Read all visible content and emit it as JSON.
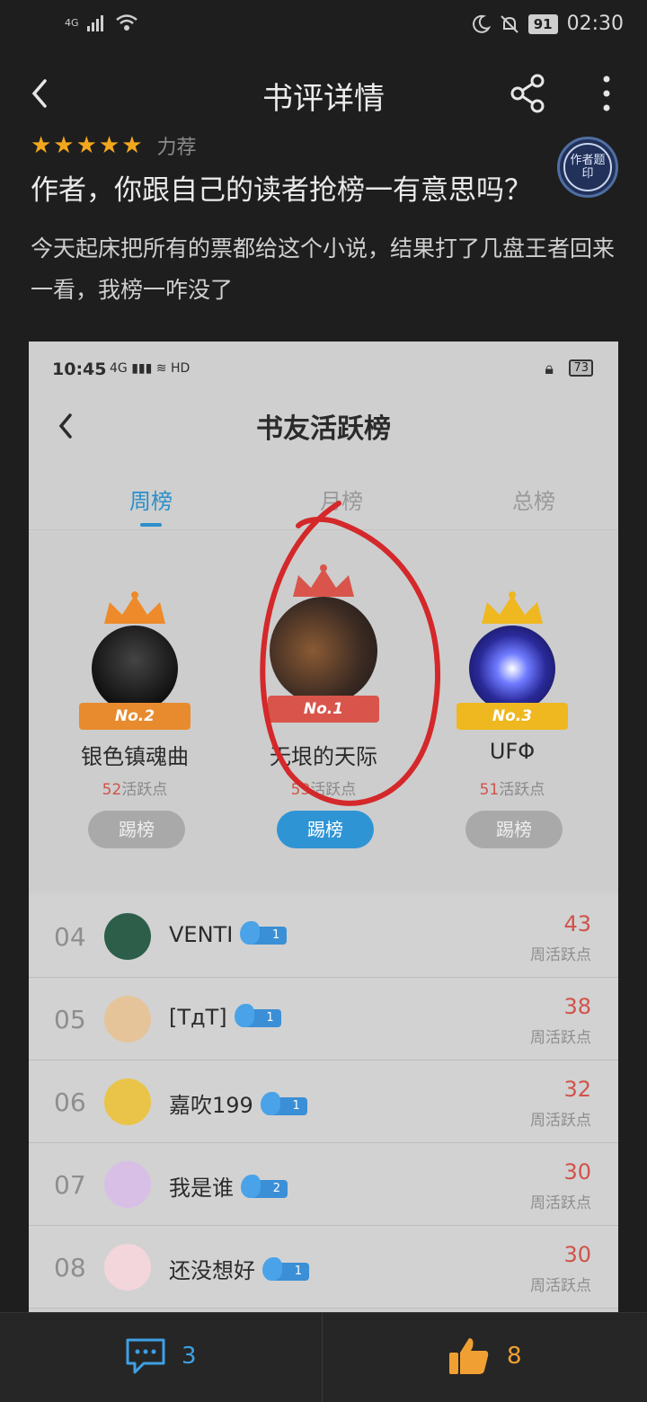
{
  "status_bar": {
    "network": "4G",
    "battery": "91",
    "time": "02:30"
  },
  "appbar": {
    "title": "书评详情"
  },
  "review": {
    "stars": "★★★★★",
    "rating_label": "力荐",
    "title": "作者，你跟自己的读者抢榜一有意思吗？",
    "stamp_text": "作者题印",
    "body": "今天起床把所有的票都给这个小说，结果打了几盘王者回来一看，我榜一咋没了"
  },
  "screenshot": {
    "status": {
      "time": "10:45",
      "icons": "4G ▮▮▮ ≋ HD",
      "battery": "73"
    },
    "title": "书友活跃榜",
    "tabs": [
      {
        "label": "周榜",
        "active": true
      },
      {
        "label": "月榜",
        "active": false
      },
      {
        "label": "总榜",
        "active": false
      }
    ],
    "podium": [
      {
        "rank": "No.2",
        "name": "银色镇魂曲",
        "score": "52",
        "score_unit": "活跃点",
        "button": "踢榜"
      },
      {
        "rank": "No.1",
        "name": "无垠的天际",
        "score": "53",
        "score_unit": "活跃点",
        "button": "踢榜"
      },
      {
        "rank": "No.3",
        "name": "UFΦ",
        "score": "51",
        "score_unit": "活跃点",
        "button": "踢榜"
      }
    ],
    "list": [
      {
        "rank": "04",
        "name": "VENTI",
        "level": "1",
        "score": "43",
        "score_label": "周活跃点"
      },
      {
        "rank": "05",
        "name": "[TдT]",
        "level": "1",
        "score": "38",
        "score_label": "周活跃点"
      },
      {
        "rank": "06",
        "name": "嘉吹199",
        "level": "1",
        "score": "32",
        "score_label": "周活跃点"
      },
      {
        "rank": "07",
        "name": "我是谁",
        "level": "2",
        "score": "30",
        "score_label": "周活跃点"
      },
      {
        "rank": "08",
        "name": "还没想好",
        "level": "1",
        "score": "30",
        "score_label": "周活跃点"
      }
    ]
  },
  "bottom_bar": {
    "comment_count": "3",
    "like_count": "8"
  },
  "colors": {
    "background": "#1e1e1e",
    "accent_blue": "#3ea0e4",
    "accent_orange": "#f0a033",
    "star": "#f2a81d",
    "score_red": "#d0534a"
  }
}
